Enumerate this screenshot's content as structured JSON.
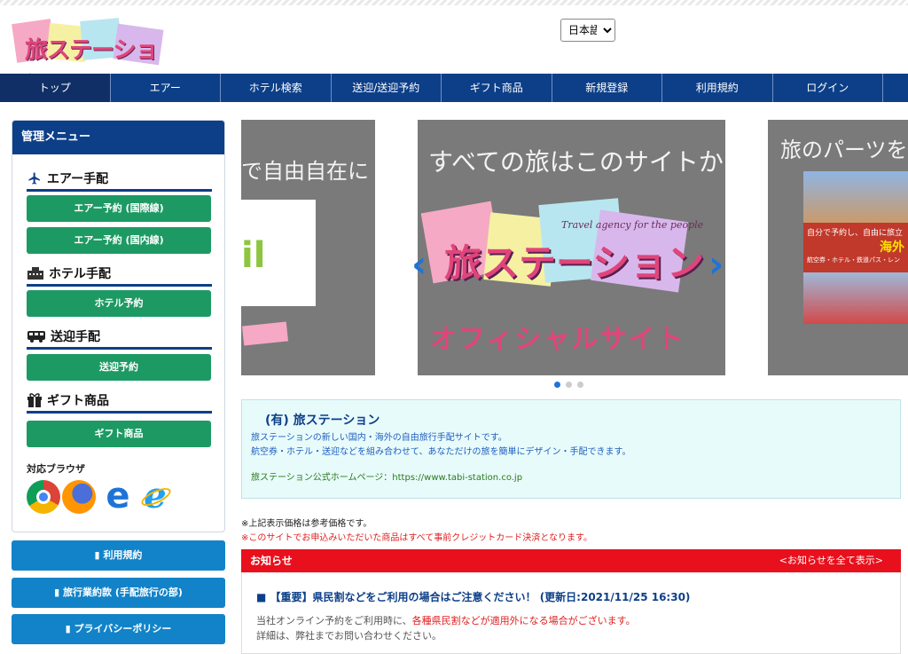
{
  "site": {
    "logo_text": "旅ステーション",
    "language": "日本語"
  },
  "nav": [
    {
      "label": "トップ"
    },
    {
      "label": "エアー"
    },
    {
      "label": "ホテル検索"
    },
    {
      "label": "送迎/送迎予約"
    },
    {
      "label": "ギフト商品"
    },
    {
      "label": "新規登録"
    },
    {
      "label": "利用規約"
    },
    {
      "label": "ログイン"
    }
  ],
  "sidebar": {
    "title": "管理メニュー",
    "sections": [
      {
        "title": "エアー手配",
        "icon": "airplane-icon",
        "buttons": [
          "エアー予約 (国際線)",
          "エアー予約 (国内線)"
        ]
      },
      {
        "title": "ホテル手配",
        "icon": "hotel-icon",
        "buttons": [
          "ホテル予約"
        ]
      },
      {
        "title": "送迎手配",
        "icon": "bus-icon",
        "buttons": [
          "送迎予約"
        ]
      },
      {
        "title": "ギフト商品",
        "icon": "gift-icon",
        "buttons": [
          "ギフト商品"
        ]
      }
    ],
    "browser_label": "対応ブラウザ",
    "links": [
      "利用規約",
      "旅行業約款 (手配旅行の部)",
      "プライバシーポリシー"
    ]
  },
  "slider": {
    "left_caption": "で自由自在に",
    "left_mail": "il",
    "center_caption": "すべての旅はこのサイトから",
    "center_tagline": "Travel agency for the people",
    "center_logo": "旅ステーション",
    "center_official": "オフィシャルサイト",
    "right_caption": "旅のパーツを備",
    "right_banner1": "自分で予約し、自由に旅立",
    "right_banner2": "海外",
    "right_banner3": "航空券・ホテル・鉄道パス・レン"
  },
  "info": {
    "title": "(有) 旅ステーション",
    "line1": "旅ステーションの新しい国内・海外の自由旅行手配サイトです。",
    "line2": "航空券・ホテル・送迎などを組み合わせて、あなただけの旅を簡単にデザイン・手配できます。",
    "line3": "旅ステーション公式ホームページ：https://www.tabi-station.co.jp"
  },
  "notes": {
    "price": "※上記表示価格は参考価格です。",
    "payment": "※このサイトでお申込みいただいた商品はすべて事前クレジットカード決済となります。"
  },
  "news": {
    "header": "お知らせ",
    "show_all": "<お知らせを全て表示>",
    "item_title": "■ 【重要】県民割などをご利用の場合はご注意ください！ (更新日:2021/11/25 16:30)",
    "body_prefix": "当社オンライン予約をご利用時に、",
    "body_red": "各種県民割などが適用外になる場合がございます。",
    "body_line2": "詳細は、弊社までお問い合わせください。"
  },
  "colors": {
    "nav": "#0d3f88",
    "green_button": "#1d9a63",
    "blue_button": "#1283c8",
    "news_bar": "#e8101c"
  }
}
